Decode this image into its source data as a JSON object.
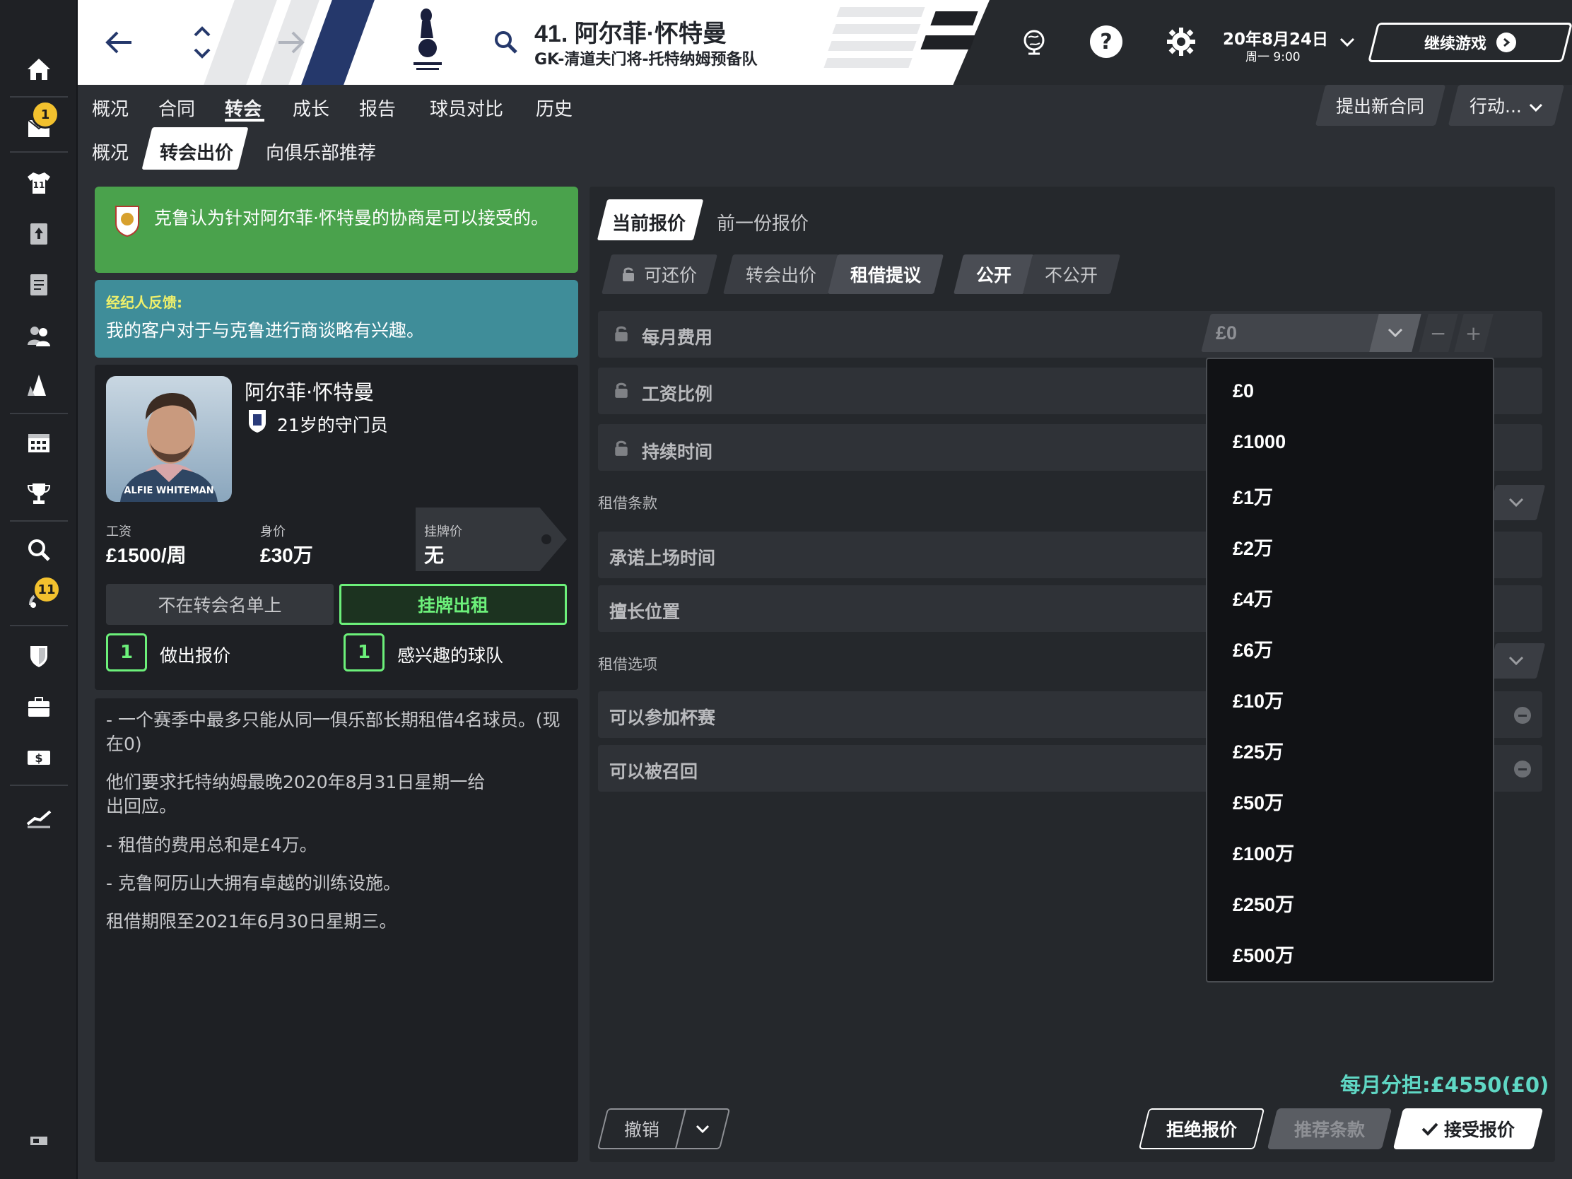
{
  "header": {
    "player_title": "41. 阿尔菲·怀特曼",
    "player_subtitle": "GK-清道夫门将-托特纳姆预备队",
    "date": "20年8月24日",
    "time": "周一 9:00",
    "continue_label": "继续游戏"
  },
  "sidebar": {
    "inbox_badge": "1",
    "scouting_badge": "11"
  },
  "nav": {
    "tabs": [
      "概况",
      "合同",
      "转会",
      "成长",
      "报告",
      "球员对比",
      "历史"
    ],
    "subtabs": [
      "概况",
      "转会出价",
      "向俱乐部推荐"
    ],
    "propose_contract": "提出新合同",
    "actions": "行动..."
  },
  "messages": {
    "green": "克鲁认为针对阿尔菲·怀特曼的协商是可以接受的。",
    "agent_title": "经纪人反馈:",
    "agent_text": "我的客户对于与克鲁进行商谈略有兴趣。"
  },
  "player_card": {
    "name": "阿尔菲·怀特曼",
    "age_position": "21岁的守门员",
    "photo_caption": "ALFIE WHITEMAN",
    "wage_label": "工资",
    "wage_value": "£1500/周",
    "value_label": "身价",
    "value_value": "£30万",
    "asking_label": "挂牌价",
    "asking_value": "无",
    "not_listed": "不在转会名单上",
    "loan_listed": "挂牌出租",
    "offers_count": "1",
    "offers_label": "做出报价",
    "interested_count": "1",
    "interested_label": "感兴趣的球队"
  },
  "notes": [
    "- 一个赛季中最多只能从同一俱乐部长期租借4名球员。(现在0)",
    "他们要求托特纳姆最晚2020年8月31日星期一给出回应。",
    "- 租借的费用总和是£4万。",
    "- 克鲁阿历山大拥有卓越的训练设施。",
    "租借期限至2021年6月30日星期三。"
  ],
  "offer": {
    "tab_current": "当前报价",
    "tab_previous": "前一份报价",
    "negotiable": "可还价",
    "transfer_bid": "转会出价",
    "loan_offer": "租借提议",
    "public": "公开",
    "private": "不公开",
    "monthly_fee_label": "每月费用",
    "monthly_fee_value": "£0",
    "wage_ratio_label": "工资比例",
    "duration_label": "持续时间",
    "loan_terms_label": "租借条款",
    "promised_time_label": "承诺上场时间",
    "position_label": "擅长位置",
    "loan_options_label": "租借选项",
    "cup_label": "可以参加杯赛",
    "recall_label": "可以被召回",
    "monthly_share": "每月分担:£4550(£0)",
    "cancel": "撤销",
    "reject": "拒绝报价",
    "suggest": "推荐条款",
    "accept": "接受报价"
  },
  "dropdown_options": [
    "£0",
    "£1000",
    "£1万",
    "£2万",
    "£4万",
    "£6万",
    "£10万",
    "£25万",
    "£50万",
    "£100万",
    "£250万",
    "£500万"
  ],
  "colors": {
    "green": "#4aa24c",
    "teal": "#3f8d99",
    "accent_green": "#6cf07a",
    "share_text": "#5fd7c4"
  }
}
